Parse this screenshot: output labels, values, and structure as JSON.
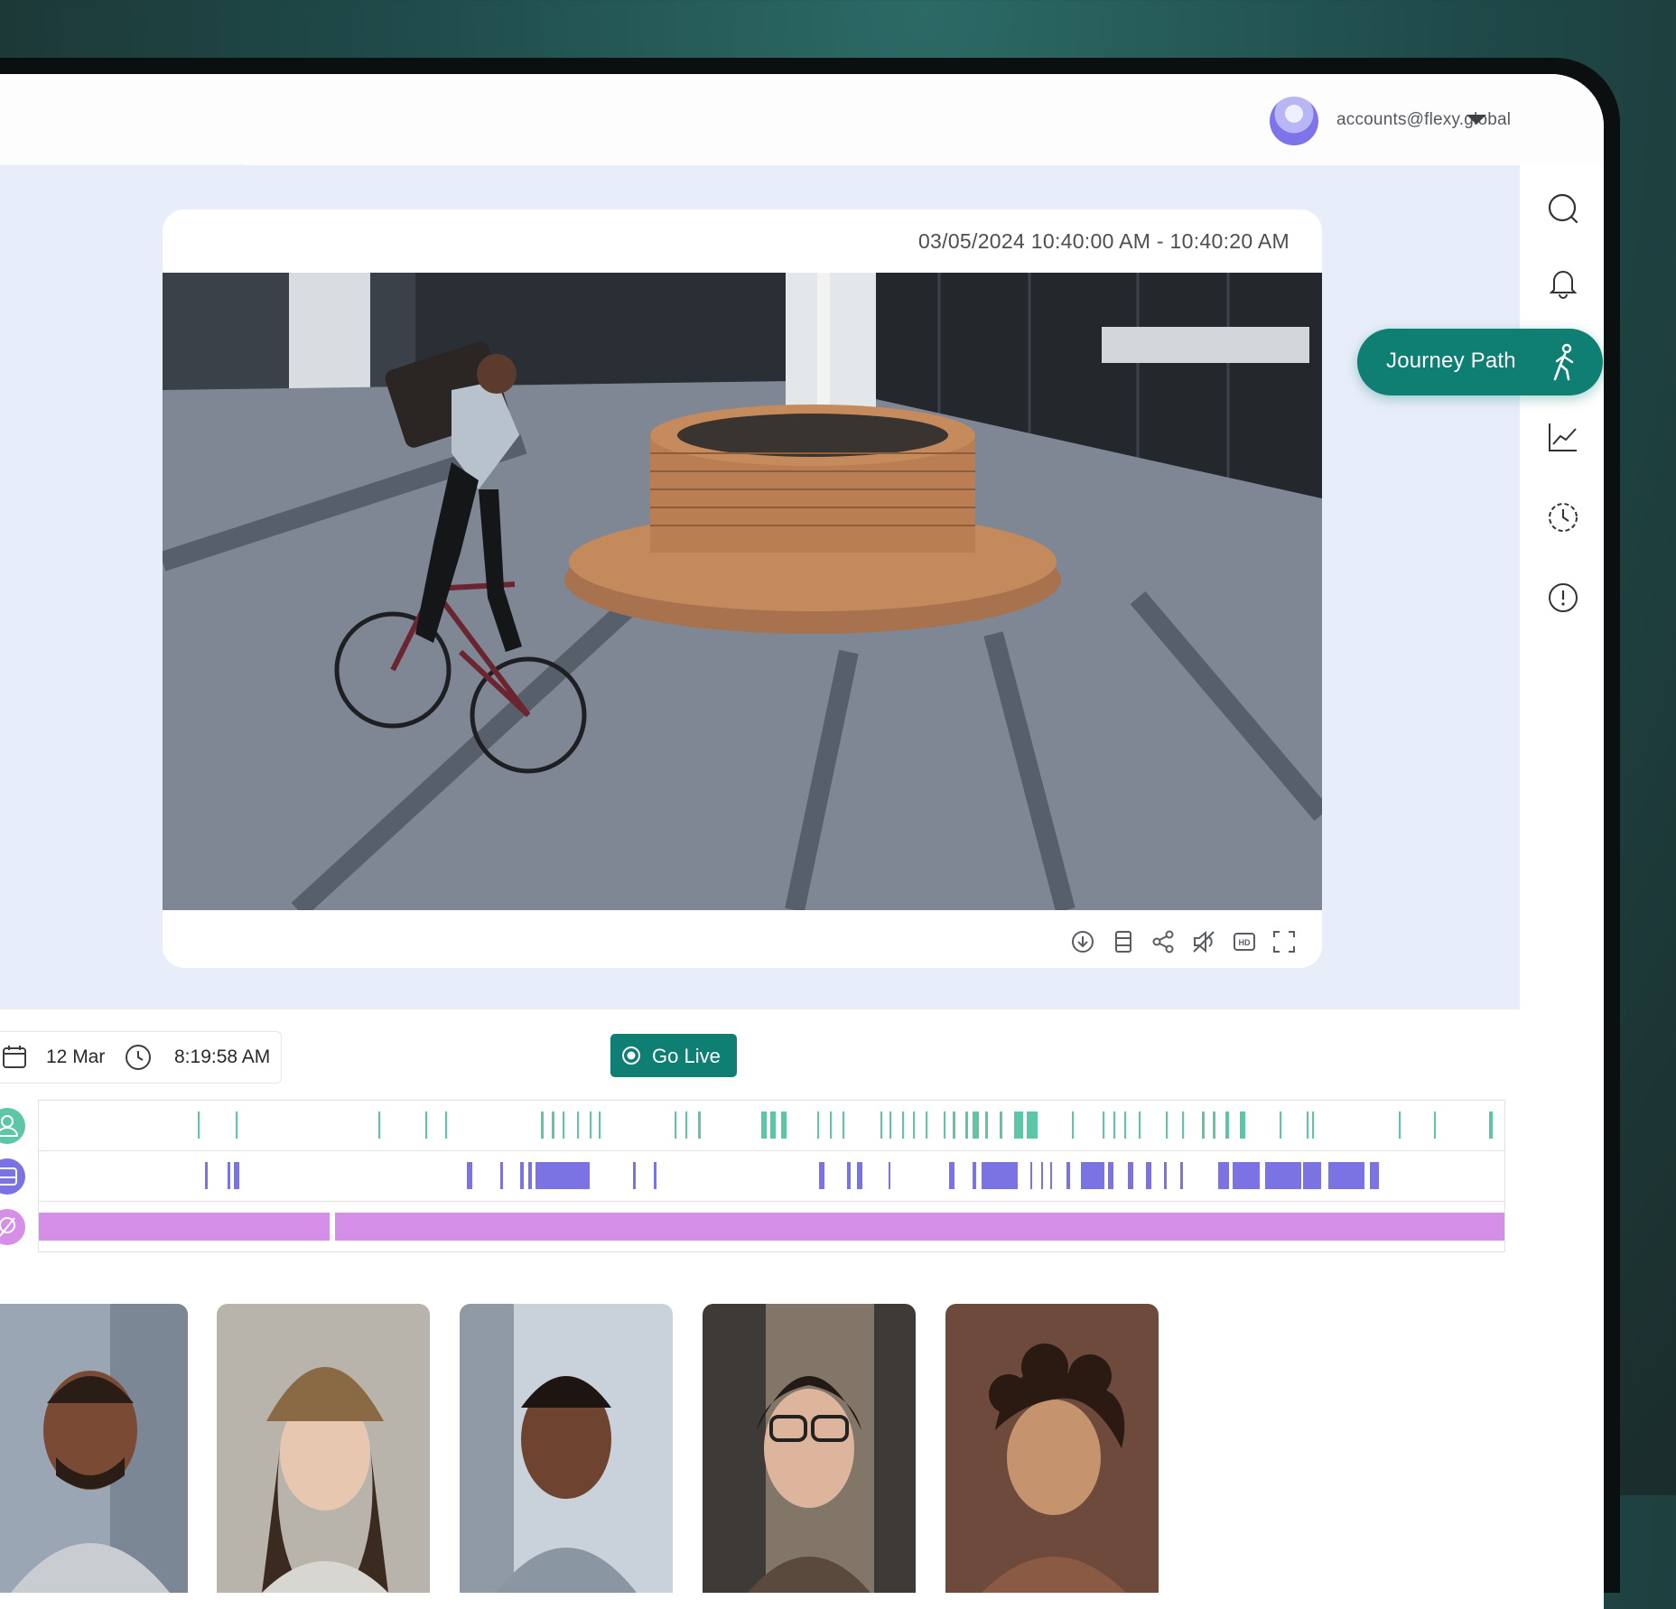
{
  "account": {
    "email": "accounts@flexy.global"
  },
  "video": {
    "timestamp": "03/05/2024  10:40:00 AM - 10:40:20 AM"
  },
  "rail": {
    "icons": [
      "search-icon",
      "bell-icon",
      "journey-path-icon",
      "chart-icon",
      "history-icon",
      "alert-icon"
    ],
    "journey_label": "Journey Path"
  },
  "controls": [
    "download-icon",
    "film-icon",
    "share-icon",
    "mute-icon",
    "hd-icon",
    "fullscreen-icon"
  ],
  "timeline": {
    "date": "12 Mar",
    "time": "8:19:58 AM",
    "go_live": "Go Live",
    "tracks": [
      "people",
      "vehicles",
      "motion"
    ],
    "colors": {
      "people": "#5cc6a6",
      "vehicles": "#7b72e3",
      "motion": "#d58fe8",
      "accent": "#0f7e73"
    }
  },
  "thumbnails": [
    "person-1",
    "person-2",
    "person-3",
    "person-4",
    "person-5"
  ]
}
